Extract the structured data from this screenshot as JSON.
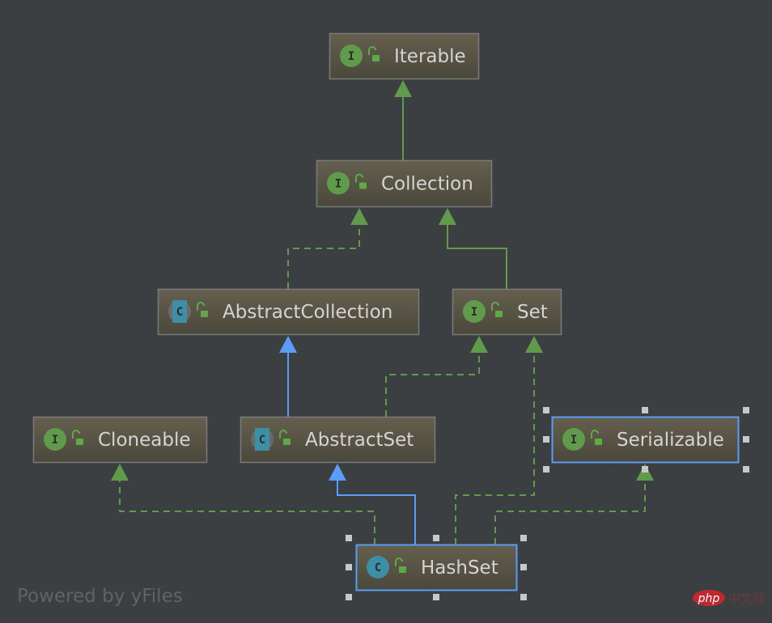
{
  "colors": {
    "background": "#3c3f41",
    "node_fill_top": "#625d4d",
    "node_fill_bottom": "#4c4a3d",
    "interface_badge": "#5f9b4a",
    "class_badge": "#3d8fa6",
    "inherit_edge": "#5f9b4a",
    "extends_edge": "#589df6",
    "selection": "#589df6"
  },
  "nodes": [
    {
      "id": "iterable",
      "label": "Iterable",
      "kind": "interface",
      "badge": "I",
      "icon": "unlocked-public-icon"
    },
    {
      "id": "collection",
      "label": "Collection",
      "kind": "interface",
      "badge": "I",
      "icon": "unlocked-public-icon"
    },
    {
      "id": "abstractcollection",
      "label": "AbstractCollection",
      "kind": "abstract-class",
      "badge": "C",
      "icon": "unlocked-public-icon"
    },
    {
      "id": "set",
      "label": "Set",
      "kind": "interface",
      "badge": "I",
      "icon": "unlocked-public-icon"
    },
    {
      "id": "cloneable",
      "label": "Cloneable",
      "kind": "interface",
      "badge": "I",
      "icon": "unlocked-public-icon"
    },
    {
      "id": "abstractset",
      "label": "AbstractSet",
      "kind": "abstract-class",
      "badge": "C",
      "icon": "unlocked-public-icon"
    },
    {
      "id": "serializable",
      "label": "Serializable",
      "kind": "interface",
      "badge": "I",
      "icon": "unlocked-public-icon",
      "selected": true
    },
    {
      "id": "hashset",
      "label": "HashSet",
      "kind": "class",
      "badge": "C",
      "icon": "unlocked-public-icon",
      "selected": true
    }
  ],
  "edges": [
    {
      "from": "collection",
      "to": "iterable",
      "type": "extends-interface",
      "style": "solid"
    },
    {
      "from": "abstractcollection",
      "to": "collection",
      "type": "implements",
      "style": "dashed"
    },
    {
      "from": "set",
      "to": "collection",
      "type": "extends-interface",
      "style": "solid"
    },
    {
      "from": "abstractset",
      "to": "abstractcollection",
      "type": "extends-class",
      "style": "solid"
    },
    {
      "from": "abstractset",
      "to": "set",
      "type": "implements",
      "style": "dashed"
    },
    {
      "from": "hashset",
      "to": "cloneable",
      "type": "implements",
      "style": "dashed"
    },
    {
      "from": "hashset",
      "to": "abstractset",
      "type": "extends-class",
      "style": "solid"
    },
    {
      "from": "hashset",
      "to": "set",
      "type": "implements",
      "style": "dashed"
    },
    {
      "from": "hashset",
      "to": "serializable",
      "type": "implements",
      "style": "dashed"
    }
  ],
  "footer": {
    "text": "Powered by yFiles"
  },
  "watermark": {
    "logo": "php",
    "text": "中文网"
  }
}
